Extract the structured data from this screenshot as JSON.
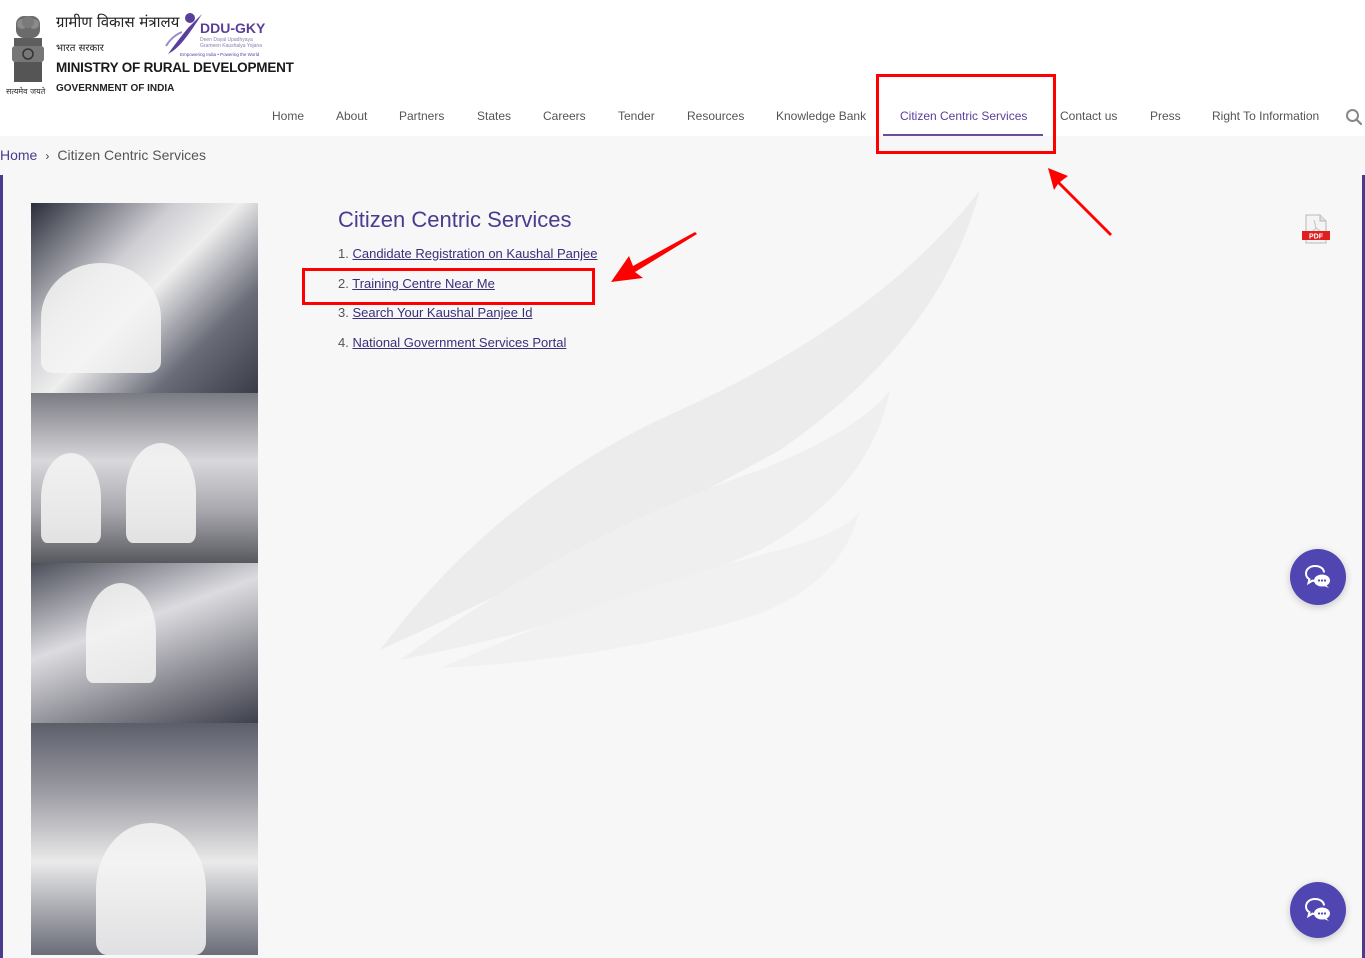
{
  "header": {
    "emblem_motto": "सत्यमेव जयते",
    "hindi_ministry": "ग्रामीण विकास मंत्रालय",
    "hindi_govt": "भारत सरकार",
    "ministry_name": "MINISTRY OF RURAL DEVELOPMENT",
    "government": "GOVERNMENT OF INDIA",
    "ddu_logo": {
      "title": "DDU-GKY",
      "subtitle_line1": "Deen Dayal Upadhyaya",
      "subtitle_line2": "Grameen Kaushalya Yojana",
      "tagline": "Empowering India • Powering the World"
    }
  },
  "nav": {
    "items": [
      {
        "label": "Home"
      },
      {
        "label": "About"
      },
      {
        "label": "Partners"
      },
      {
        "label": "States"
      },
      {
        "label": "Careers"
      },
      {
        "label": "Tender"
      },
      {
        "label": "Resources"
      },
      {
        "label": "Knowledge Bank"
      },
      {
        "label": "Citizen Centric Services",
        "active": true
      },
      {
        "label": "Contact us"
      },
      {
        "label": "Press"
      },
      {
        "label": "Right To Information"
      }
    ],
    "search_icon": "search-icon",
    "active_color": "#5a3e9b"
  },
  "breadcrumb": {
    "home": "Home",
    "separator": "›",
    "current": "Citizen Centric Services"
  },
  "content": {
    "title": "Citizen Centric Services",
    "services": [
      {
        "number": "1.",
        "label": "Candidate Registration on Kaushal Panjee"
      },
      {
        "number": "2.",
        "label": "Training Centre Near Me"
      },
      {
        "number": "3.",
        "label": "Search Your Kaushal Panjee Id"
      },
      {
        "number": "4.",
        "label": "National Government Services Portal"
      }
    ],
    "pdf_label": "PDF"
  },
  "chat_buttons": [
    {
      "icon": "chat-bubbles-icon"
    },
    {
      "icon": "chat-bubbles-icon"
    }
  ],
  "colors": {
    "brand_purple": "#4b3b8f",
    "chat_button": "#5046b2",
    "annotation_red": "#ff0000"
  }
}
